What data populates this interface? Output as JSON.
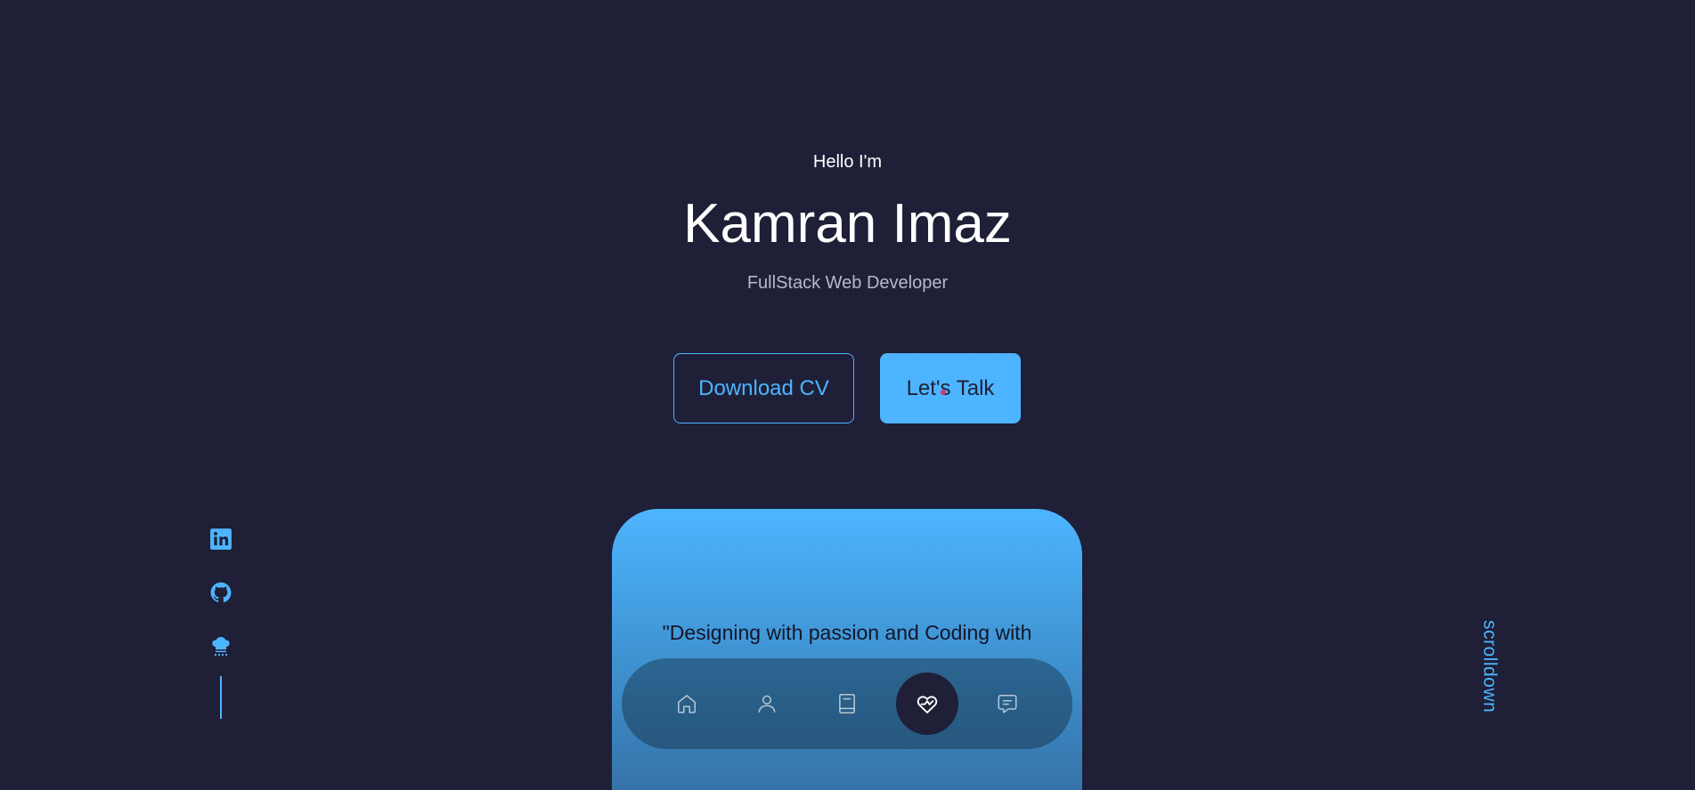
{
  "header": {
    "greeting": "Hello I'm",
    "name": "Kamran Imaz",
    "role": "FullStack Web Developer"
  },
  "cta": {
    "download_label": "Download CV",
    "talk_label": "Let's Talk"
  },
  "socials": {
    "items": [
      {
        "icon": "linkedin-icon"
      },
      {
        "icon": "github-icon"
      },
      {
        "icon": "chef-hat-icon"
      }
    ]
  },
  "scroll": {
    "label": "scrolldown"
  },
  "card": {
    "quote": "\"Designing with passion and Coding with"
  },
  "nav": {
    "items": [
      {
        "icon": "home-icon",
        "active": false
      },
      {
        "icon": "user-icon",
        "active": false
      },
      {
        "icon": "book-icon",
        "active": false
      },
      {
        "icon": "services-icon",
        "active": true
      },
      {
        "icon": "message-icon",
        "active": false
      }
    ]
  },
  "colors": {
    "background": "#1f1f38",
    "primary": "#4db5ff",
    "muted_text": "#b8b8c8"
  }
}
